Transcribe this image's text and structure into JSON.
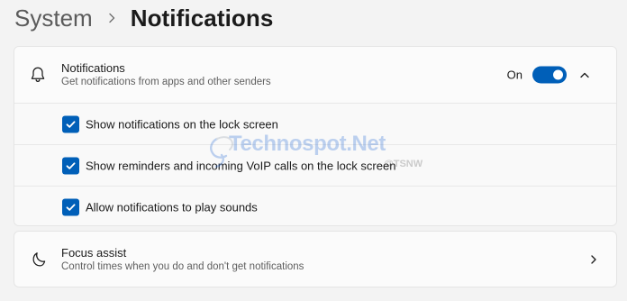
{
  "breadcrumb": {
    "parent": "System",
    "current": "Notifications"
  },
  "notifications": {
    "title": "Notifications",
    "subtitle": "Get notifications from apps and other senders",
    "toggle_state": "On",
    "toggle_on": true,
    "icon": "bell-icon",
    "collapse_icon": "chevron-up-icon",
    "options": [
      {
        "label": "Show notifications on the lock screen",
        "checked": true
      },
      {
        "label": "Show reminders and incoming VoIP calls on the lock screen",
        "checked": true
      },
      {
        "label": "Allow notifications to play sounds",
        "checked": true
      }
    ]
  },
  "focus_assist": {
    "title": "Focus assist",
    "subtitle": "Control times when you do and don't get notifications",
    "icon": "moon-icon",
    "chevron_icon": "chevron-right-icon"
  },
  "watermark": {
    "brand": "Technospot.Net",
    "handle": "@TSNW"
  },
  "colors": {
    "accent": "#005fb8",
    "background": "#f3f3f3",
    "card": "#fbfbfb",
    "watermark_blue": "#3b78d8"
  }
}
